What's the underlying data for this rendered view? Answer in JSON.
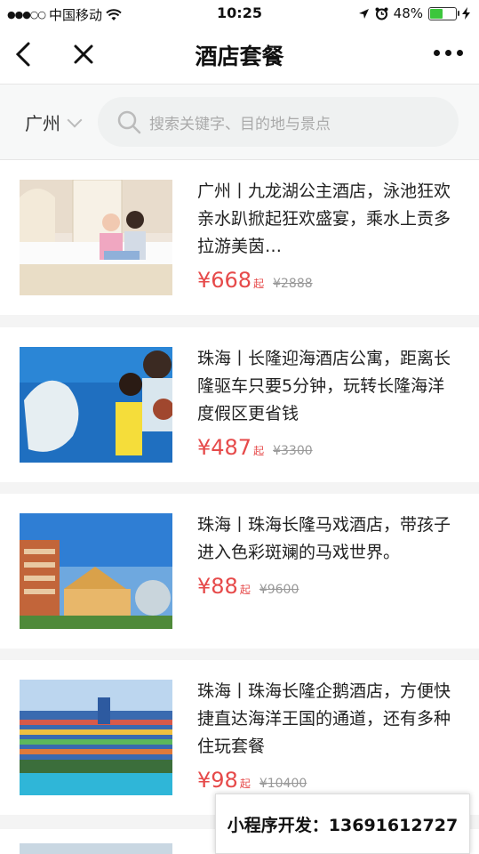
{
  "status_bar": {
    "signal": "●●●○○",
    "carrier": "中国移动",
    "time": "10:25",
    "battery_text": "48%",
    "battery_level": 0.48,
    "battery_color": "#3cc63c"
  },
  "nav": {
    "title": "酒店套餐"
  },
  "filter": {
    "city": "广州",
    "search_placeholder": "搜索关键字、目的地与景点"
  },
  "accent_color": "#e64a4a",
  "items": [
    {
      "title": "广州丨九龙湖公主酒店，泳池狂欢亲水趴掀起狂欢盛宴，乘水上贡多拉游美茵…",
      "price": "¥668",
      "price_suffix": "起",
      "original_price": "¥2888"
    },
    {
      "title": "珠海丨长隆迎海酒店公寓，距离长隆驱车只要5分钟，玩转长隆海洋度假区更省钱",
      "price": "¥487",
      "price_suffix": "起",
      "original_price": "¥3300"
    },
    {
      "title": "珠海丨珠海长隆马戏酒店，带孩子进入色彩斑斓的马戏世界。",
      "price": "¥88",
      "price_suffix": "起",
      "original_price": "¥9600"
    },
    {
      "title": "珠海丨珠海长隆企鹅酒店，方便快捷直达海洋王国的通道，还有多种住玩套餐",
      "price": "¥98",
      "price_suffix": "起",
      "original_price": "¥10400"
    }
  ],
  "watermark": "小程序开发：13691612727"
}
